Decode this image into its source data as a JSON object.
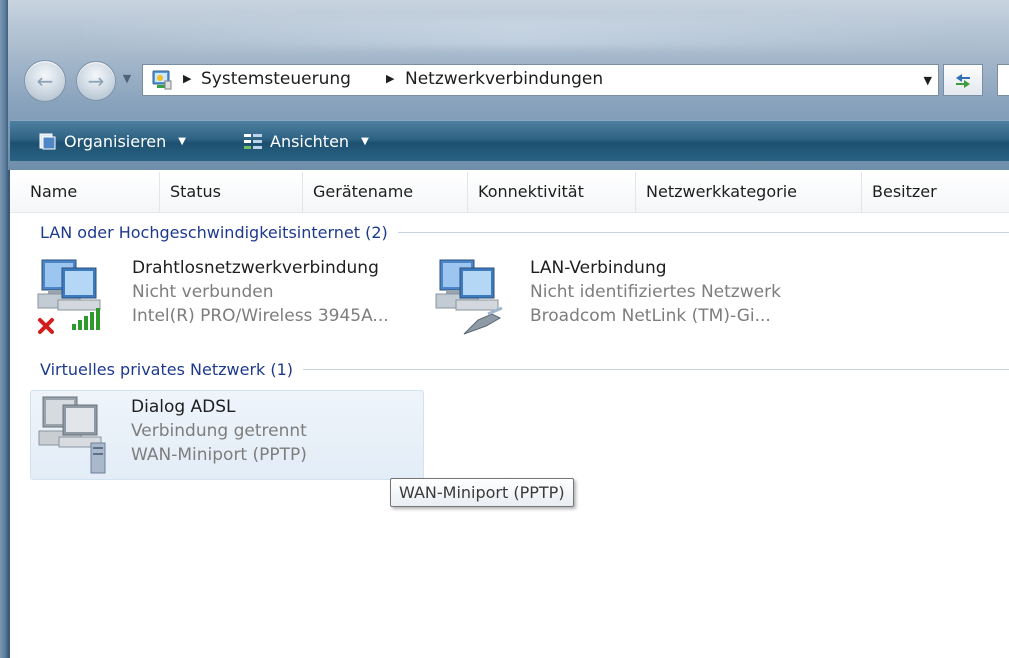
{
  "navigation": {
    "back_arrow": "←",
    "forward_arrow": "→",
    "dropdown_arrow": "▼"
  },
  "address_bar": {
    "breadcrumbs": [
      "Systemsteuerung",
      "Netzwerkverbindungen"
    ],
    "separator": "▶",
    "dropdown_arrow": "▼",
    "refresh_glyph": "↻"
  },
  "toolbar": {
    "organize_label": "Organisieren",
    "views_label": "Ansichten",
    "caret": "▼"
  },
  "columns": [
    "Name",
    "Status",
    "Gerätename",
    "Konnektivität",
    "Netzwerkkategorie",
    "Besitzer"
  ],
  "groups": [
    {
      "title": "LAN oder Hochgeschwindigkeitsinternet (2)",
      "items": [
        {
          "name": "Drahtlosnetzwerkverbindung",
          "status": "Nicht verbunden",
          "device": "Intel(R) PRO/Wireless 3945A...",
          "icon": "wireless-network-icon"
        },
        {
          "name": "LAN-Verbindung",
          "status": "Nicht identifiziertes Netzwerk",
          "device": "Broadcom NetLink (TM)-Gi...",
          "icon": "lan-network-icon"
        }
      ]
    },
    {
      "title": "Virtuelles privates Netzwerk (1)",
      "items": [
        {
          "name": "Dialog ADSL",
          "status": "Verbindung getrennt",
          "device": "WAN-Miniport (PPTP)",
          "icon": "vpn-connection-icon"
        }
      ]
    }
  ],
  "tooltip": "WAN-Miniport (PPTP)",
  "colors": {
    "toolbar": "#1d5070",
    "group_header_text": "#1e3a8c",
    "secondary_text": "#7d7d7d",
    "selection": "#e3edf7"
  }
}
